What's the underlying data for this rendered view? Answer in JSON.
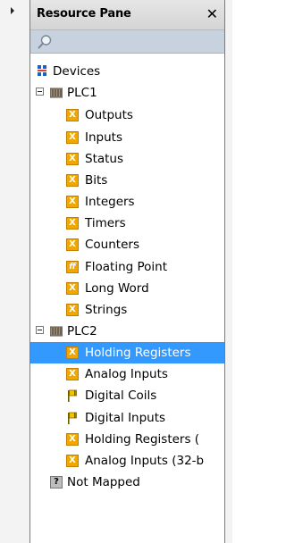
{
  "pane": {
    "title": "Resource Pane",
    "close_glyph": "✕"
  },
  "tree": {
    "root": {
      "label": "Devices",
      "icon": "devices-icon"
    },
    "plc1": {
      "label": "PLC1",
      "items": [
        "Outputs",
        "Inputs",
        "Status",
        "Bits",
        "Integers",
        "Timers",
        "Counters",
        "Floating Point",
        "Long Word",
        "Strings"
      ],
      "icons": [
        "x-register-icon",
        "x-register-icon",
        "x-register-icon",
        "x-register-icon",
        "x-register-icon",
        "x-register-icon",
        "x-register-icon",
        "float-register-icon",
        "x-register-icon",
        "x-register-icon"
      ]
    },
    "plc2": {
      "label": "PLC2",
      "items": [
        "Holding Registers",
        "Analog Inputs",
        "Digital Coils",
        "Digital Inputs",
        "Holding Registers (",
        "Analog Inputs (32-b"
      ],
      "icons": [
        "x-register-icon",
        "x-register-icon",
        "flag-icon",
        "flag-icon",
        "x-register-icon",
        "x-register-icon"
      ],
      "selected_index": 0
    },
    "not_mapped": {
      "label": "Not Mapped",
      "icon": "question-icon"
    }
  },
  "colors": {
    "selection": "#3399ff",
    "register_icon": "#f0a800",
    "search_bar": "#c8d2de"
  }
}
